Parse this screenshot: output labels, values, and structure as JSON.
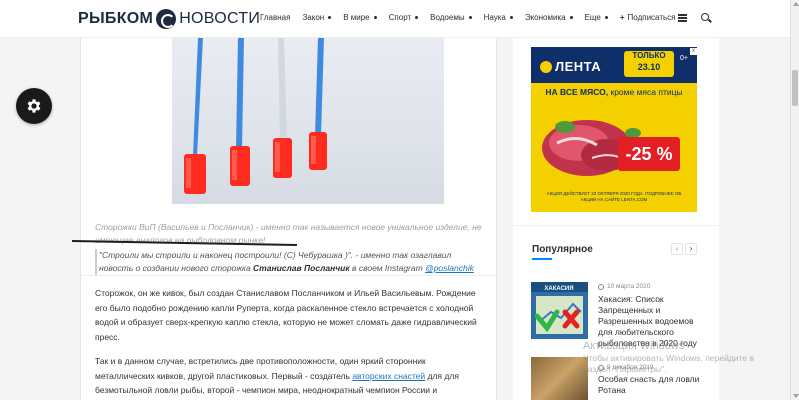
{
  "header": {
    "logo_part1": "РЫБКОМ",
    "logo_part2": "НОВОСТИ",
    "nav": [
      {
        "label": "Главная",
        "dropdown": false
      },
      {
        "label": "Закон",
        "dropdown": true
      },
      {
        "label": "В мире",
        "dropdown": true
      },
      {
        "label": "Спорт",
        "dropdown": true
      },
      {
        "label": "Водоемы",
        "dropdown": true
      },
      {
        "label": "Наука",
        "dropdown": true
      },
      {
        "label": "Экономика",
        "dropdown": true
      },
      {
        "label": "Еще",
        "dropdown": true
      }
    ],
    "subscribe_label": "Подписаться",
    "menu_icon": "hamburger-icon",
    "search_icon": "search-icon"
  },
  "article": {
    "caption": "Сторожки ВиП (Васильев и Посланчик) - именно так называется новое уникальное изделие, не имеющее аналогов на рыболовном рынке!",
    "quote_text": "\"Строили мы строили и наконец построили! (С) Чебурашка )\". - именно так озаглавил новость о создании нового сторожка ",
    "quote_name": "Станислав Посланчик",
    "quote_after": " в своем Instagram ",
    "quote_instagram": "@poslanchik",
    "para1": "Сторожок, он же кивок, был создан Станиславом Посланчиком и Ильей Васильевым. Рождение его было подобно рождению капли Руперта, когда раскаленное стекло встречается с холодной водой и образует сверх-крепкую каплю стекла, которую не может сломать даже гидравлический пресс.",
    "para2_before": "Так и в данном случае, встретились две противоположности, один яркий сторонник металлических кивков, другой пластиковых. Первый - создатель ",
    "para2_link": "авторских снастей",
    "para2_after": " для для безмотыльной ловли рыбы, второй - чемпион мира, неоднократный чемпион России и"
  },
  "ad": {
    "brand": "ЛЕНТА",
    "only_label": "ТОЛЬКО",
    "date_label": "23.10",
    "age_label": "0+",
    "close_label": "x",
    "offer_bold": "НА ВСЕ МЯСО,",
    "offer_rest": " кроме мяса птицы",
    "discount": "-25 %",
    "fine_print": "АКЦИЯ ДЕЙСТВУЕТ 23 ОКТЯБРЯ 2020 ГОДА. ПОДРОБНЕЕ ОБ АКЦИИ НА САЙТЕ LENTA.COM",
    "colors": {
      "navy": "#0f2f6b",
      "yellow": "#f5d000",
      "red": "#e31e24"
    }
  },
  "popular": {
    "title": "Популярное",
    "prev_label": "‹",
    "next_label": "›",
    "items": [
      {
        "date": "10 марта 2020",
        "title": "Хакасия: Список Запрещенных и Разрешенных водоемов для любительского рыболовства в 2020 году",
        "image_label": "ХАКАСИЯ"
      },
      {
        "date": "9 декабря 2019",
        "title": "Особая снасть для ловли Ротана",
        "image_label": ""
      }
    ]
  },
  "watermark": {
    "line1": "Активация Windows",
    "line2": "Чтобы активировать Windows, перейдите в раздел \"Параметры\"."
  },
  "colors": {
    "accent": "#0088ff",
    "link": "#1e73be",
    "text": "#2c2f34",
    "settings_button": "#1a1a1a"
  }
}
